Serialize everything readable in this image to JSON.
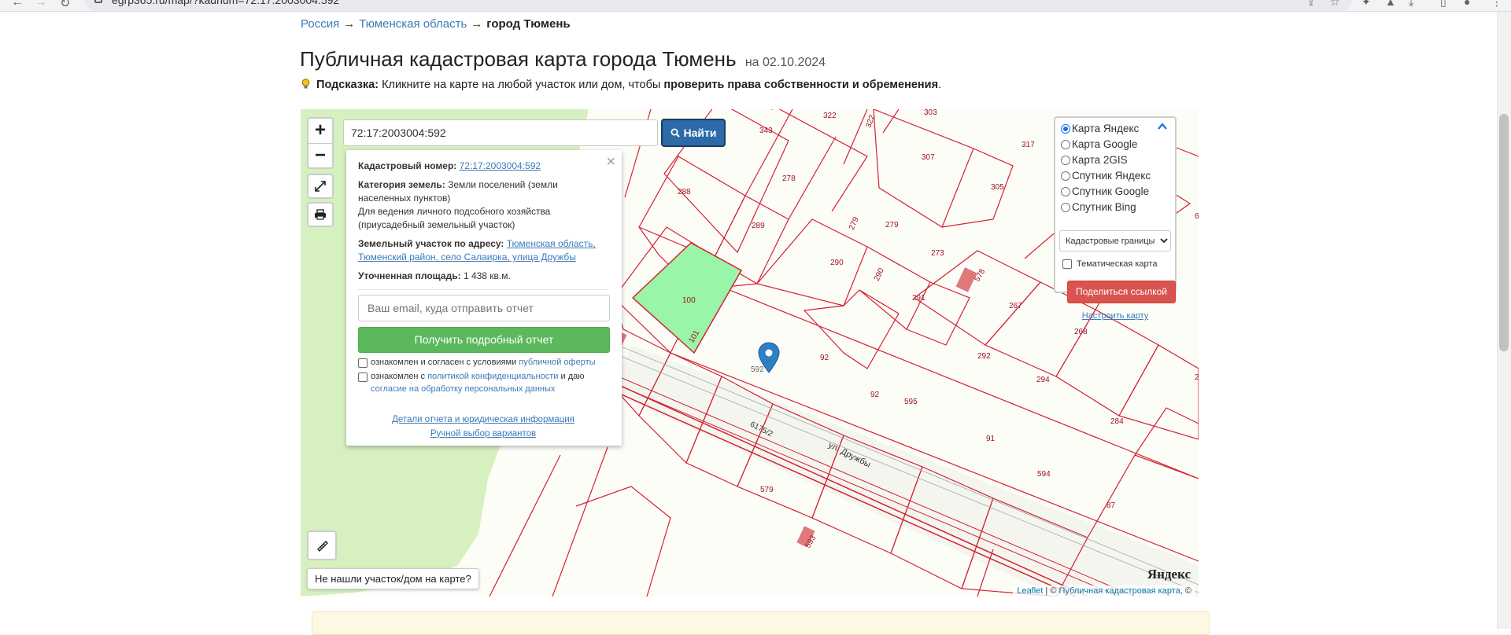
{
  "browser": {
    "url": "egrp365.ru/map/?kadnum=72:17:2003004:592"
  },
  "breadcrumb": {
    "items": [
      {
        "label": "Россия"
      },
      {
        "label": "Тюменская область"
      }
    ],
    "current": "город Тюмень",
    "separator": "→"
  },
  "page": {
    "title": "Публичная кадастровая карта города Тюмень",
    "date": "на 02.10.2024"
  },
  "hint": {
    "label": "Подсказка:",
    "text": "Кликните на карте на любой участок или дом, чтобы",
    "bold_text": "проверить права собственности и обременения",
    "end": "."
  },
  "map_ui": {
    "zoom_in": "+",
    "zoom_out": "−",
    "search_value": "72:17:2003004:592",
    "search_button": "Найти",
    "not_found": "Не нашли участок/дом на карте?",
    "attribution_leaflet": "Leaflet",
    "attribution_sep": "| ©",
    "attribution_pkk": "Публичная кадастровая карта,",
    "attribution_end": "©",
    "yandex_logo": "Яндекс",
    "fullscreen_icon": "expand-icon",
    "print_icon": "printer-icon",
    "ruler_icon": "ruler-icon"
  },
  "popup": {
    "cad_label": "Кадастровый номер:",
    "cad_value": "72:17:2003004:592",
    "category_label": "Категория земель:",
    "category_value": "Земли поселений (земли населенных пунктов)",
    "purpose": "Для ведения личного подсобного хозяйства (приусадебный земельный участок)",
    "address_label": "Земельный участок по адресу:",
    "address_value": "Тюменская область, Тюменский район, село Салаирка, улица Дружбы",
    "area_label": "Уточненная площадь:",
    "area_value": "1 438 кв.м.",
    "email_placeholder": "Ваш email, куда отправить отчет",
    "report_button": "Получить подробный отчет",
    "check1_text": "ознакомлен и согласен с условиями",
    "check1_link": "публичной оферты",
    "check2_text": "ознакомлен с",
    "check2_link": "политикой конфиденциальности",
    "check2_mid": "и даю",
    "check2_link2": "согласие на обработку персональных данных",
    "details_link": "Детали отчета и юридическая информация",
    "manual_link": "Ручной выбор вариантов"
  },
  "layers": {
    "options": [
      {
        "label": "Карта Яндекс",
        "selected": true
      },
      {
        "label": "Карта Google",
        "selected": false
      },
      {
        "label": "Карта 2GIS",
        "selected": false
      },
      {
        "label": "Спутник Яндекс",
        "selected": false
      },
      {
        "label": "Спутник Google",
        "selected": false
      },
      {
        "label": "Спутник Bing",
        "selected": false
      }
    ],
    "select_value": "Кадастровые границы",
    "thematic_label": "Тематическая карта",
    "share_button": "Поделиться ссылкой",
    "setup_link": "Настроить карту"
  },
  "parcels": {
    "labels": [
      "343",
      "322",
      "322",
      "303",
      "317",
      "307",
      "305",
      "288",
      "278",
      "289",
      "279",
      "279",
      "273",
      "578",
      "290",
      "290",
      "291",
      "100",
      "101",
      "592",
      "92",
      "92",
      "267",
      "268",
      "292",
      "294",
      "595",
      "91",
      "284",
      "594",
      "579",
      "593",
      "87",
      "2",
      "6"
    ],
    "road_labels": [
      "6175/2",
      "ул. Дружбы"
    ]
  },
  "colors": {
    "parcel_border": "#d4202f",
    "parcel_label": "#9c1420",
    "selected_parcel": "#99f5a8",
    "green_area": "#d6f0bf",
    "building": "#e07a7a",
    "marker": "#2f7fc4"
  }
}
